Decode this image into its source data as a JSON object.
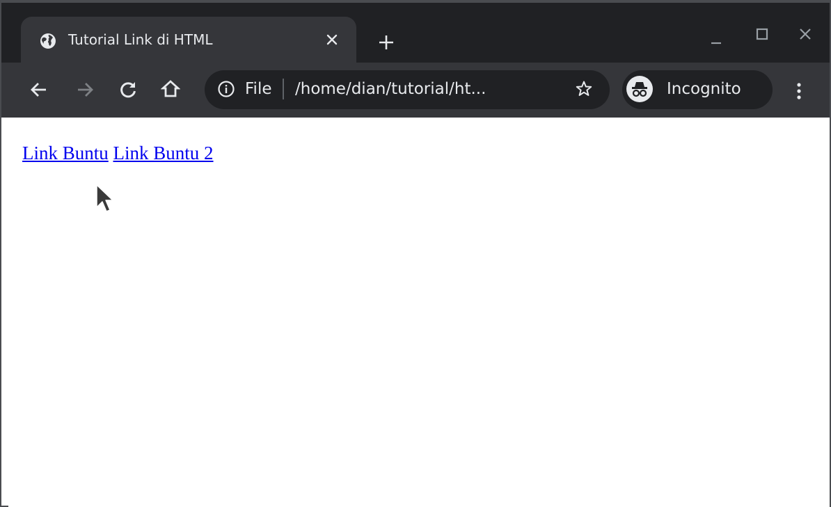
{
  "browser": {
    "tab": {
      "title": "Tutorial Link di HTML",
      "favicon": "globe-icon"
    },
    "omnibox": {
      "scheme": "File",
      "url": "/home/dian/tutorial/ht..."
    },
    "profile": {
      "label": "Incognito",
      "icon": "incognito-icon"
    },
    "colors": {
      "frame": "#202124",
      "toolbar": "#35363a",
      "text": "#e8eaed"
    }
  },
  "page": {
    "links": [
      {
        "label": "Link Buntu"
      },
      {
        "label": "Link Buntu 2"
      }
    ],
    "link_color": "#0000ee"
  }
}
